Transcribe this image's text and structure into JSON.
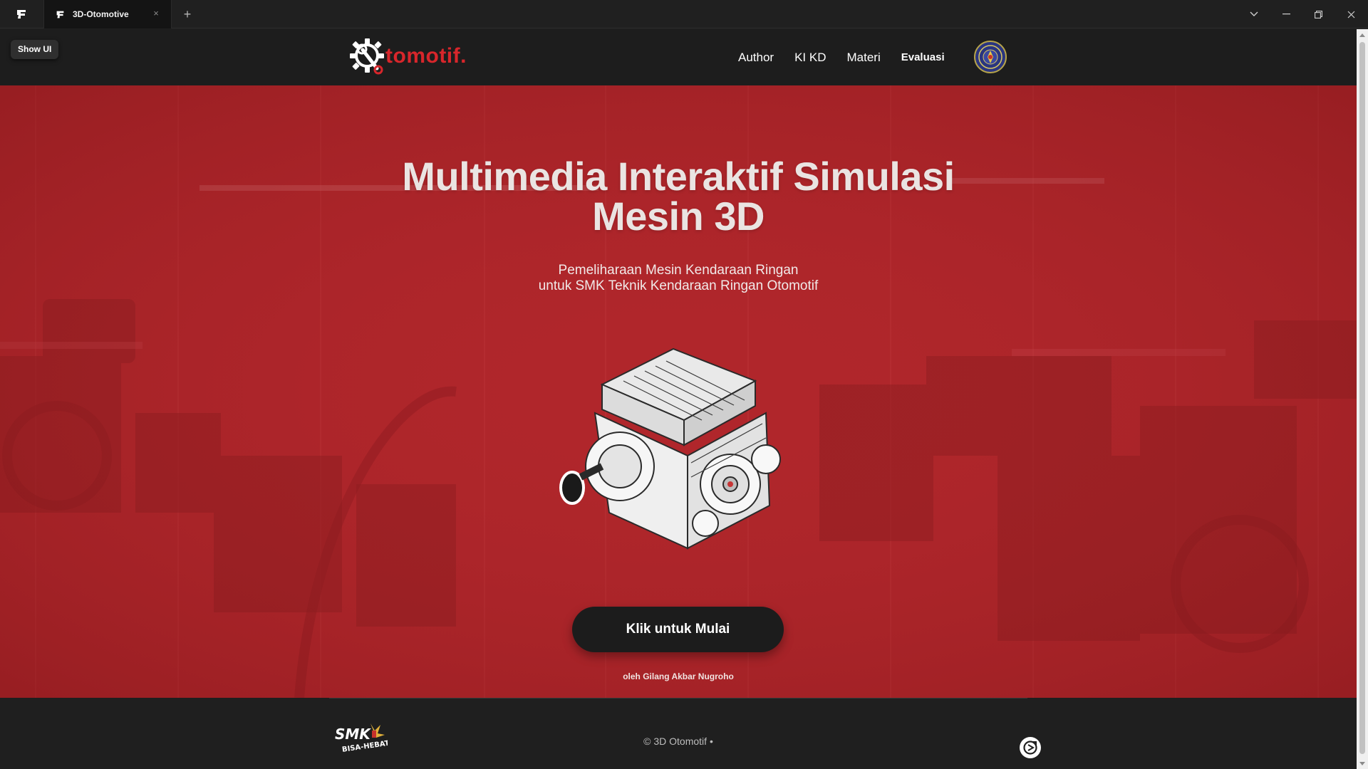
{
  "browser": {
    "tab_title": "3D-Otomotive",
    "tab_close": "×",
    "new_tab": "+"
  },
  "site": {
    "show_ui_label": "Show UI",
    "logo_text": "tomotif.",
    "nav": [
      {
        "label": "Author"
      },
      {
        "label": "KI KD"
      },
      {
        "label": "Materi"
      },
      {
        "label": "Evaluasi"
      }
    ]
  },
  "hero": {
    "title_line1": "Multimedia Interaktif Simulasi",
    "title_line2": "Mesin 3D",
    "subtitle_line1": "Pemeliharaan Mesin Kendaraan Ringan",
    "subtitle_line2": "untuk SMK Teknik Kendaraan Ringan Otomotif",
    "cta_label": "Klik untuk Mulai",
    "byline": "oleh Gilang Akbar Nugroho"
  },
  "footer": {
    "smk_logo_text": "SMK",
    "smk_logo_sub": "BISA-HEBAT",
    "copyright": "© 3D Otomotif •"
  },
  "colors": {
    "brand_red": "#d8262b",
    "hero_red": "#b0262b",
    "dark": "#1d1d1d"
  },
  "icons": {
    "app": "app-logo-icon",
    "tab": "app-logo-icon",
    "logo": "gear-wrench-icon",
    "emblem": "university-emblem-icon",
    "footer": "opencart-icon"
  }
}
